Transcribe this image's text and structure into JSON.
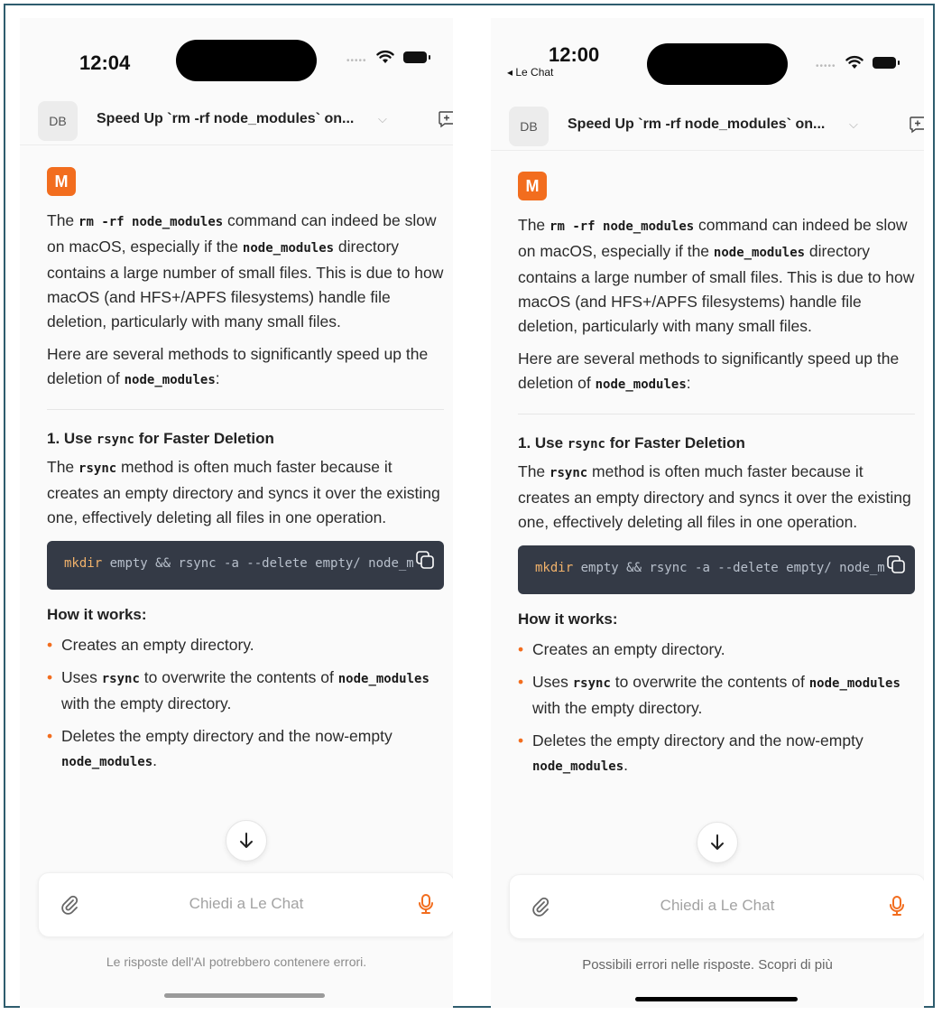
{
  "screens": [
    {
      "status_time": "12:04",
      "back_label": "",
      "header": {
        "avatar": "DB",
        "title": "Speed Up `rm -rf node_modules` on..."
      },
      "logo": "M",
      "intro": {
        "t1": "The ",
        "c1": "rm -rf node_modules",
        "t2": " command can indeed be slow on macOS, especially if the ",
        "c2": "node_modules",
        "t3": " directory contains a large number of small files. This is due to how macOS (and HFS+/APFS filesystems) handle file deletion, particularly with many small files."
      },
      "methods_intro": {
        "t1": "Here are several methods to significantly speed up the deletion of ",
        "c1": "node_modules",
        "t2": ":"
      },
      "section": {
        "prefix": "1. Use ",
        "code": "rsync",
        "suffix": " for Faster Deletion"
      },
      "section_para": {
        "t1": "The ",
        "c1": "rsync",
        "t2": " method is often much faster because it creates an empty directory and syncs it over the existing one, effectively deleting all files in one operation."
      },
      "code": {
        "keyword": "mkdir",
        "rest": " empty && rsync -a --delete empty/ node_m"
      },
      "how_title": "How it works:",
      "bullets": [
        {
          "t1": "Creates an empty directory.",
          "c1": "",
          "t2": ""
        },
        {
          "t1": "Uses ",
          "c1": "rsync",
          "t2": " to overwrite the contents of ",
          "c2": "node_modules",
          "t3": " with the empty directory."
        },
        {
          "t1": "Deletes the empty directory and the now-empty ",
          "c1": "node_modules",
          "t2": "."
        }
      ],
      "input_placeholder": "Chiedi a Le Chat",
      "disclaimer": "Le risposte dell'AI potrebbero contenere errori."
    },
    {
      "status_time": "12:00",
      "back_label": "◂ Le Chat",
      "header": {
        "avatar": "DB",
        "title": "Speed Up `rm -rf node_modules` on..."
      },
      "logo": "M",
      "intro": {
        "t1": "The ",
        "c1": "rm -rf node_modules",
        "t2": " command can indeed be slow on macOS, especially if the ",
        "c2": "node_modules",
        "t3": " directory contains a large number of small files. This is due to how macOS (and HFS+/APFS filesystems) handle file deletion, particularly with many small files."
      },
      "methods_intro": {
        "t1": "Here are several methods to significantly speed up the deletion of ",
        "c1": "node_modules",
        "t2": ":"
      },
      "section": {
        "prefix": "1. Use ",
        "code": "rsync",
        "suffix": " for Faster Deletion"
      },
      "section_para": {
        "t1": "The ",
        "c1": "rsync",
        "t2": " method is often much faster because it creates an empty directory and syncs it over the existing one, effectively deleting all files in one operation."
      },
      "code": {
        "keyword": "mkdir",
        "rest": " empty && rsync -a --delete empty/ node_m"
      },
      "how_title": "How it works:",
      "bullets": [
        {
          "t1": "Creates an empty directory.",
          "c1": "",
          "t2": ""
        },
        {
          "t1": "Uses ",
          "c1": "rsync",
          "t2": " to overwrite the contents of ",
          "c2": "node_modules",
          "t3": " with the empty directory."
        },
        {
          "t1": "Deletes the empty directory and the now-empty ",
          "c1": "node_modules",
          "t2": "."
        }
      ],
      "input_placeholder": "Chiedi a Le Chat",
      "disclaimer": "Possibili errori nelle risposte. Scopri di più"
    }
  ],
  "colors": {
    "accent": "#f26d1e",
    "code_bg": "#343a46",
    "border": "#2f5d6e"
  },
  "icons": [
    "wifi-icon",
    "battery-icon",
    "new-chat-icon",
    "copy-icon",
    "arrow-down-icon",
    "paperclip-icon",
    "microphone-icon"
  ]
}
